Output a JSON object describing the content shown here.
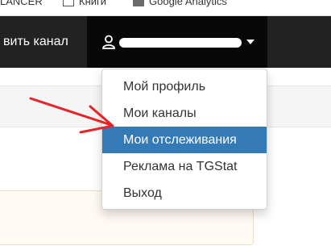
{
  "bookmarks": [
    {
      "label": "LANCER",
      "icon": "none"
    },
    {
      "label": "Книги",
      "icon": "folder-icon"
    },
    {
      "label": "Google Analytics",
      "icon": "analytics-icon"
    }
  ],
  "navbar": {
    "add_channel_label": "вить канал",
    "user_name": "●●●●●●●●●●●●●",
    "user_icon": "user-icon",
    "caret_icon": "caret-down-icon"
  },
  "dropdown": {
    "items": [
      {
        "label": "Мой профиль",
        "active": false
      },
      {
        "label": "Мои каналы",
        "active": false
      },
      {
        "label": "Мои отслеживания",
        "active": true
      },
      {
        "label": "Реклама на TGStat",
        "active": false
      },
      {
        "label": "Выход",
        "active": false
      }
    ]
  },
  "colors": {
    "navbar_bg": "#222222",
    "user_menu_bg": "#080808",
    "active_item_bg": "#337ab7",
    "annotation_arrow": "#e8232a"
  }
}
